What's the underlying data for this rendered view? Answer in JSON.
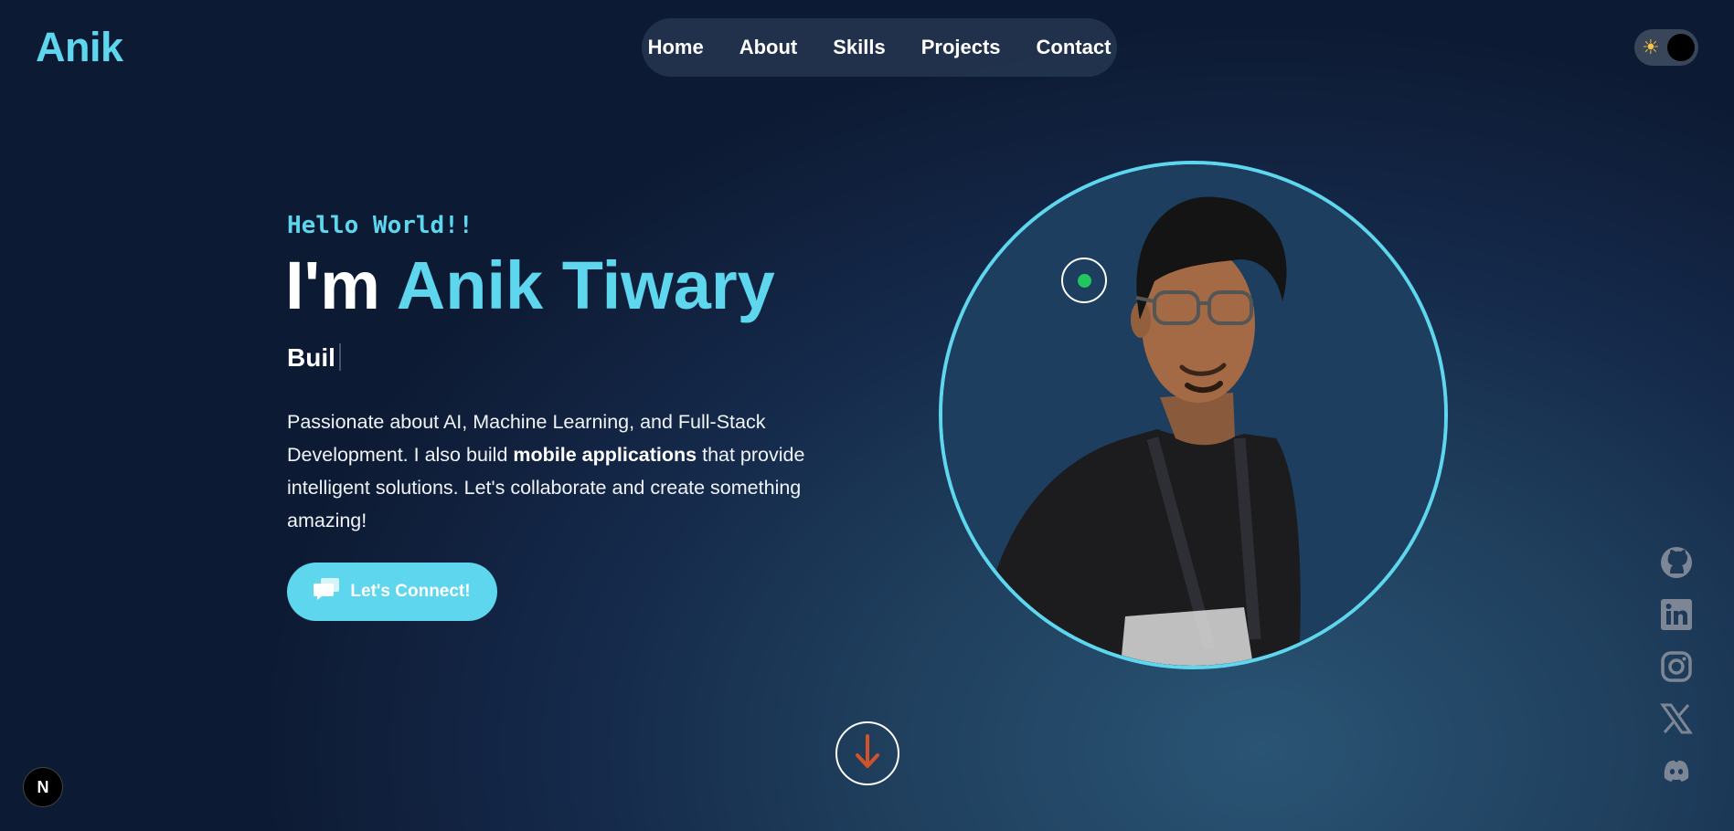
{
  "brand": {
    "logo_text": "Anik"
  },
  "nav": {
    "items": [
      {
        "label": "Home"
      },
      {
        "label": "About"
      },
      {
        "label": "Skills"
      },
      {
        "label": "Projects"
      },
      {
        "label": "Contact"
      }
    ]
  },
  "theme_toggle": {
    "icon": "sun-icon",
    "state": "dark"
  },
  "hero": {
    "greeting": "Hello World!!",
    "heading_prefix": "I'm",
    "heading_name": "Anik Tiwary",
    "typed_text": "Buil",
    "description_part1": "Passionate about AI, Machine Learning, and Full-Stack Development. I also build",
    "description_bold": "mobile applications",
    "description_part2": "that provide intelligent solutions. Let's collaborate and create something amazing!",
    "cta_label": "Let's Connect!",
    "cta_icon": "chat-icon"
  },
  "profile": {
    "status": "online",
    "status_color": "#22c55e",
    "ring_color": "#5ed6ee"
  },
  "scroll": {
    "icon": "arrow-down-icon",
    "color": "#d2532a"
  },
  "socials": [
    {
      "icon": "github-icon"
    },
    {
      "icon": "linkedin-icon"
    },
    {
      "icon": "instagram-icon"
    },
    {
      "icon": "x-icon"
    },
    {
      "icon": "discord-icon"
    }
  ],
  "dev_badge": {
    "label": "N"
  },
  "colors": {
    "accent": "#5ed6ee",
    "background": "#15294a",
    "text": "#ffffff"
  }
}
